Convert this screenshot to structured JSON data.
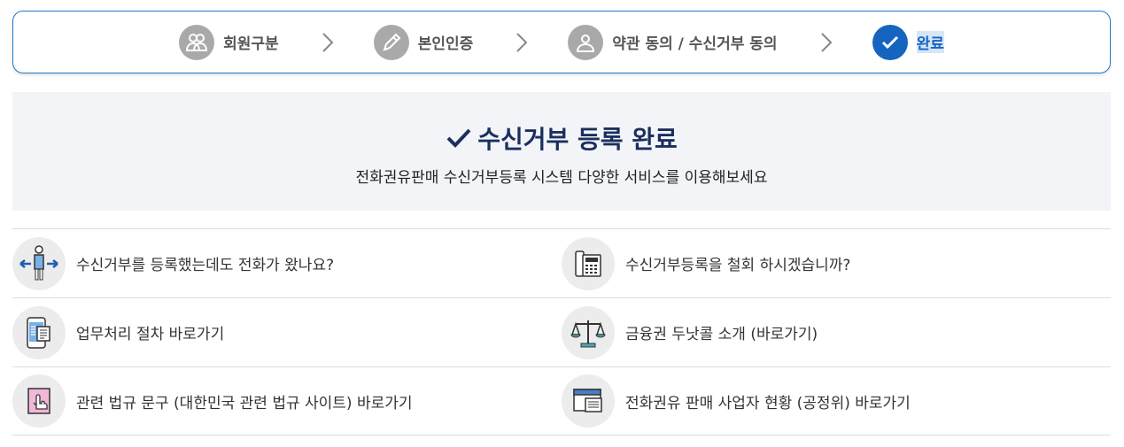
{
  "steps": [
    {
      "label": "회원구분",
      "icon": "users-icon",
      "active": false
    },
    {
      "label": "본인인증",
      "icon": "pencil-icon",
      "active": false
    },
    {
      "label": "약관 동의 / 수신거부 동의",
      "icon": "user-icon",
      "active": false
    },
    {
      "label": "완료",
      "icon": "check-icon",
      "active": true
    }
  ],
  "banner": {
    "title": "수신거부 등록 완료",
    "subtitle": "전화권유판매 수신거부등록 시스템 다양한 서비스를 이용해보세요"
  },
  "links": [
    {
      "label": "수신거부를 등록했는데도 전화가 왔나요?",
      "icon": "person-arrows-icon"
    },
    {
      "label": "수신거부등록을 철회 하시겠습니까?",
      "icon": "telephone-icon"
    },
    {
      "label": "업무처리 절차 바로가기",
      "icon": "mobile-document-icon"
    },
    {
      "label": "금융권 두낫콜 소개 (바로가기)",
      "icon": "scale-icon"
    },
    {
      "label": "관련 법규 문구 (대한민국 관련 법규 사이트) 바로가기",
      "icon": "hand-pointer-icon"
    },
    {
      "label": "전화권유 판매 사업자 현황 (공정위) 바로가기",
      "icon": "window-list-icon"
    }
  ],
  "colors": {
    "accent": "#1565c0",
    "step_inactive": "#a9a9a9",
    "banner_bg": "#f3f4f8",
    "title": "#1b2f5e"
  }
}
